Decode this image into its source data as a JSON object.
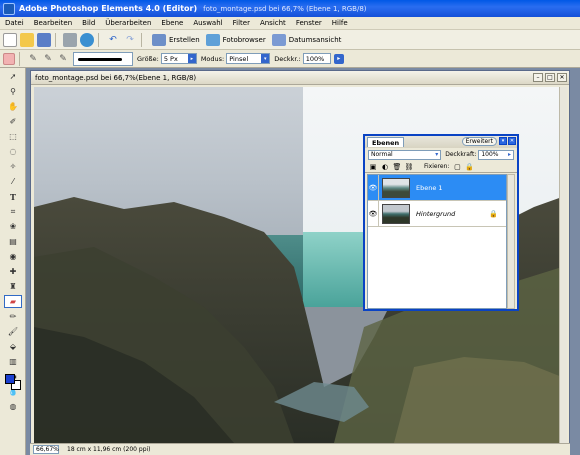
{
  "window": {
    "app_title": "Adobe Photoshop Elements 4.0 (Editor)",
    "doc_title": "foto_montage.psd bei 66,7% (Ebene 1, RGB/8)"
  },
  "menu": [
    "Datei",
    "Bearbeiten",
    "Bild",
    "Überarbeiten",
    "Ebene",
    "Auswahl",
    "Filter",
    "Ansicht",
    "Fenster",
    "Hilfe"
  ],
  "shortcuts": {
    "create_label": "Erstellen",
    "browser_label": "Fotobrowser",
    "date_view_label": "Datumsansicht"
  },
  "options": {
    "size_label": "Größe:",
    "size_value": "5 Px",
    "mode_label": "Modus:",
    "mode_value": "Pinsel",
    "opacity_label": "Deckkr.:",
    "opacity_value": "100%"
  },
  "document": {
    "title": "foto_montage.psd bei 66,7%(Ebene 1, RGB/8)"
  },
  "status": {
    "zoom": "66,67%",
    "info": "18 cm x 11,96 cm (200 ppi)"
  },
  "layers_panel": {
    "tab_label": "Ebenen",
    "more_label": "Erweitert",
    "blend_mode": "Normal",
    "opacity_label": "Deckkraft:",
    "opacity_value": "100%",
    "lock_label": "Fixieren:",
    "layers": [
      {
        "name": "Ebene 1",
        "selected": true
      },
      {
        "name": "Hintergrund",
        "selected": false,
        "locked": true
      }
    ]
  },
  "colors": {
    "foreground": "#1b3fcf",
    "background": "#ffffff",
    "selection": "#2c8cf4"
  }
}
